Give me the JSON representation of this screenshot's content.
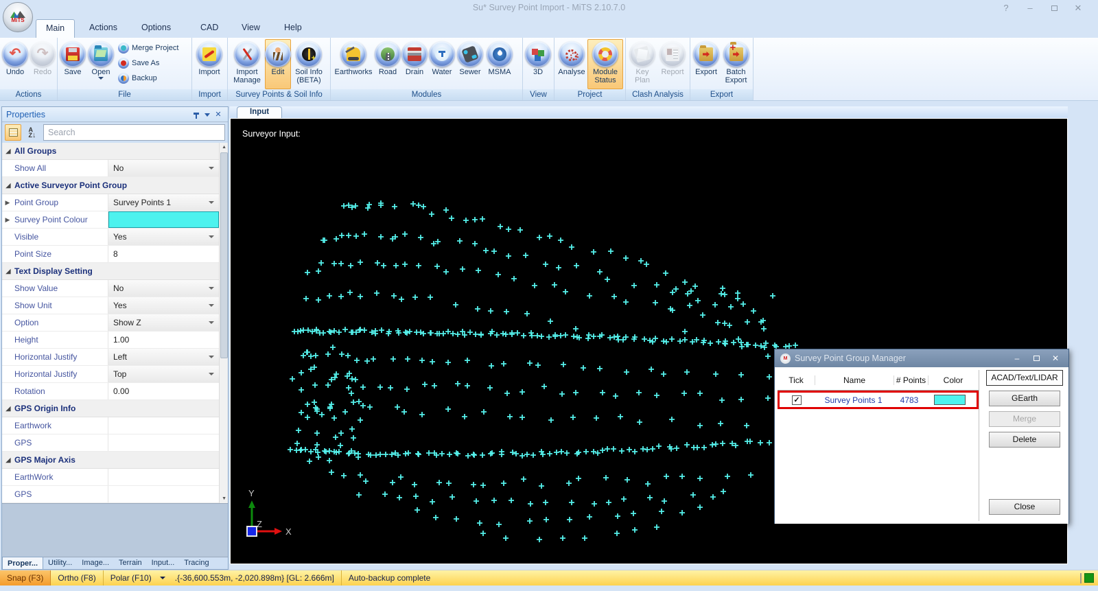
{
  "window": {
    "title": "Su* Survey Point Import - MiTS 2.10.7.0",
    "logo_text": "MiTS",
    "help": "?",
    "minimize": "–",
    "close": "✕"
  },
  "ribbon": {
    "tabs": [
      {
        "label": "Main",
        "active": true
      },
      {
        "label": "Actions"
      },
      {
        "label": "Options"
      },
      {
        "label": "CAD"
      },
      {
        "label": "View"
      },
      {
        "label": "Help"
      }
    ],
    "groups": [
      {
        "label": "Actions",
        "buttons": [
          {
            "label": "Undo"
          },
          {
            "label": "Redo",
            "disabled": true
          }
        ]
      },
      {
        "label": "File",
        "buttons": [
          {
            "label": "Save"
          },
          {
            "label": "Open",
            "dropdown": true
          }
        ],
        "small_buttons": [
          {
            "label": "Merge Project"
          },
          {
            "label": "Save As"
          },
          {
            "label": "Backup"
          }
        ]
      },
      {
        "label": "Import",
        "buttons": [
          {
            "label": "Import"
          }
        ]
      },
      {
        "label": "Survey Points & Soil Info",
        "buttons": [
          {
            "label": "Import Manage"
          },
          {
            "label": "Edit",
            "highlighted": true
          },
          {
            "label": "Soil Info (BETA)"
          }
        ]
      },
      {
        "label": "Modules",
        "buttons": [
          {
            "label": "Earthworks"
          },
          {
            "label": "Road"
          },
          {
            "label": "Drain"
          },
          {
            "label": "Water"
          },
          {
            "label": "Sewer"
          },
          {
            "label": "MSMA"
          }
        ]
      },
      {
        "label": "View",
        "buttons": [
          {
            "label": "3D"
          }
        ]
      },
      {
        "label": "Project",
        "buttons": [
          {
            "label": "Analyse"
          },
          {
            "label": "Module Status",
            "highlighted": true
          }
        ]
      },
      {
        "label": "Clash Analysis",
        "buttons": [
          {
            "label": "Key Plan",
            "disabled": true
          },
          {
            "label": "Report",
            "disabled": true
          }
        ]
      },
      {
        "label": "Export",
        "buttons": [
          {
            "label": "Export"
          },
          {
            "label": "Batch Export"
          }
        ]
      }
    ]
  },
  "properties_panel": {
    "title": "Properties",
    "search_placeholder": "Search",
    "rows": [
      {
        "type": "group",
        "label": "All Groups"
      },
      {
        "label": "Show All",
        "value": "No",
        "control": "dropdown"
      },
      {
        "type": "group",
        "label": "Active Surveyor Point Group"
      },
      {
        "label": "Point Group",
        "value": "Survey Points 1",
        "control": "dropdown",
        "expander": true
      },
      {
        "label": "Survey Point Colour",
        "value": "",
        "control": "color",
        "expander": true
      },
      {
        "label": "Visible",
        "value": "Yes",
        "control": "dropdown"
      },
      {
        "label": "Point Size",
        "value": "8",
        "control": "edit"
      },
      {
        "type": "group",
        "label": "Text Display Setting"
      },
      {
        "label": "Show Value",
        "value": "No",
        "control": "dropdown"
      },
      {
        "label": "Show Unit",
        "value": "Yes",
        "control": "dropdown"
      },
      {
        "label": "Option",
        "value": "Show Z",
        "control": "dropdown"
      },
      {
        "label": "Height",
        "value": "1.00",
        "control": "edit"
      },
      {
        "label": "Horizontal Justify",
        "value": "Left",
        "control": "dropdown"
      },
      {
        "label": "Horizontal Justify",
        "value": "Top",
        "control": "dropdown"
      },
      {
        "label": "Rotation",
        "value": "0.00",
        "control": "edit"
      },
      {
        "type": "group",
        "label": "GPS Origin Info"
      },
      {
        "label": "Earthwork",
        "value": "",
        "control": "edit"
      },
      {
        "label": "GPS",
        "value": "",
        "control": "edit"
      },
      {
        "type": "group",
        "label": "GPS Major Axis"
      },
      {
        "label": "EarthWork",
        "value": "",
        "control": "edit"
      },
      {
        "label": "GPS",
        "value": "",
        "control": "edit"
      }
    ],
    "color_swatch": "#4df2ee",
    "tabs": [
      {
        "label": "Proper...",
        "active": true
      },
      {
        "label": "Utility..."
      },
      {
        "label": "Image..."
      },
      {
        "label": "Terrain"
      },
      {
        "label": "Input..."
      },
      {
        "label": "Tracing"
      }
    ]
  },
  "canvas": {
    "tab_label": "Input",
    "overlay_label": "Surveyor Input:",
    "axis": {
      "x": "X",
      "y": "Y",
      "z": "Z"
    },
    "axis_colors": {
      "x": "#e01010",
      "y": "#0d8a0d",
      "z": "#1626e8"
    }
  },
  "point_cloud": {
    "color": "#55f1eb",
    "seed": 42,
    "marker": "plus",
    "strokes": [
      [
        163,
        128,
        285,
        106,
        735,
        258,
        36
      ],
      [
        135,
        173,
        265,
        146,
        765,
        286,
        32
      ],
      [
        117,
        218,
        255,
        186,
        785,
        310,
        30
      ],
      [
        110,
        260,
        235,
        236,
        570,
        320,
        20
      ],
      [
        93,
        310,
        365,
        306,
        823,
        333,
        110
      ],
      [
        110,
        348,
        315,
        348,
        815,
        376,
        28
      ],
      [
        115,
        384,
        365,
        392,
        810,
        410,
        28
      ],
      [
        103,
        420,
        325,
        430,
        795,
        446,
        24
      ],
      [
        85,
        483,
        365,
        500,
        780,
        470,
        85
      ],
      [
        140,
        518,
        385,
        543,
        755,
        518,
        24
      ],
      [
        195,
        543,
        445,
        573,
        725,
        543,
        20
      ],
      [
        265,
        573,
        485,
        603,
        685,
        568,
        14
      ],
      [
        365,
        603,
        505,
        623,
        625,
        593,
        8
      ]
    ],
    "scatter": [
      [
        85,
        330,
        105,
        170,
        45
      ],
      [
        615,
        248,
        200,
        100,
        20
      ]
    ]
  },
  "dialog": {
    "title": "Survey Point Group Manager",
    "logo_text": "M",
    "columns": {
      "tick": "Tick",
      "name": "Name",
      "points": "# Points",
      "color": "Color"
    },
    "row": {
      "ticked": true,
      "name": "Survey Points 1",
      "points": "4783",
      "color": "#4df2ee"
    },
    "buttons": {
      "acad": "ACAD/Text/LIDAR",
      "gearth": "GEarth",
      "merge": "Merge",
      "delete": "Delete",
      "close": "Close"
    },
    "minimize": "–",
    "close": "✕"
  },
  "status_bar": {
    "snap": "Snap (F3)",
    "ortho": "Ortho (F8)",
    "polar": "Polar (F10)",
    "coords": ".{-36,600.553m, -2,020.898m}  [GL: 2.666m]",
    "message": "Auto-backup complete"
  }
}
